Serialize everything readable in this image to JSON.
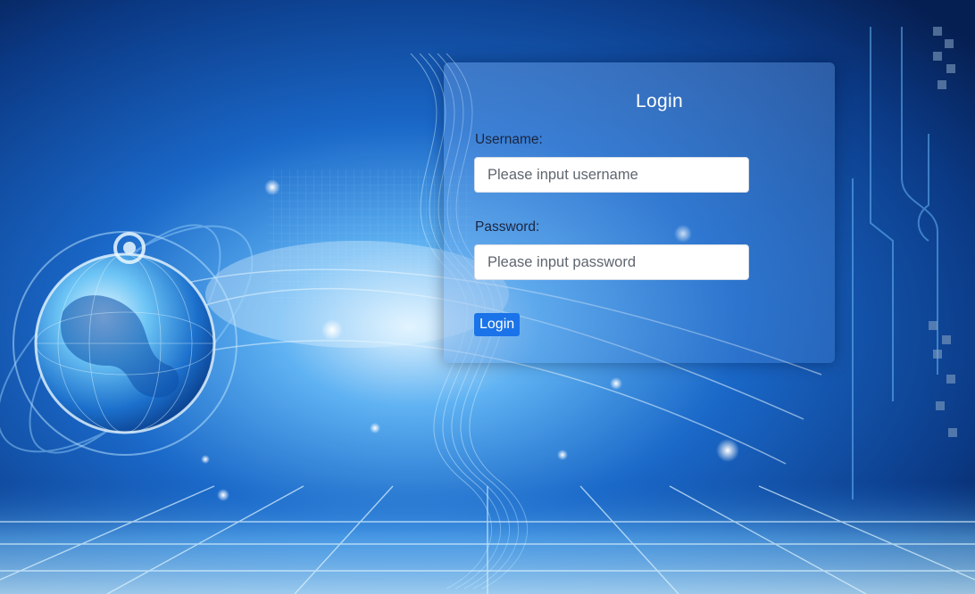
{
  "login": {
    "title": "Login",
    "username_label": "Username:",
    "username_placeholder": "Please input username",
    "password_label": "Password:",
    "password_placeholder": "Please input password",
    "submit_label": "Login"
  },
  "colors": {
    "background_dark": "#071f4f",
    "background_mid": "#1460c2",
    "glow": "#bfe6ff",
    "button": "#1a73e8"
  }
}
